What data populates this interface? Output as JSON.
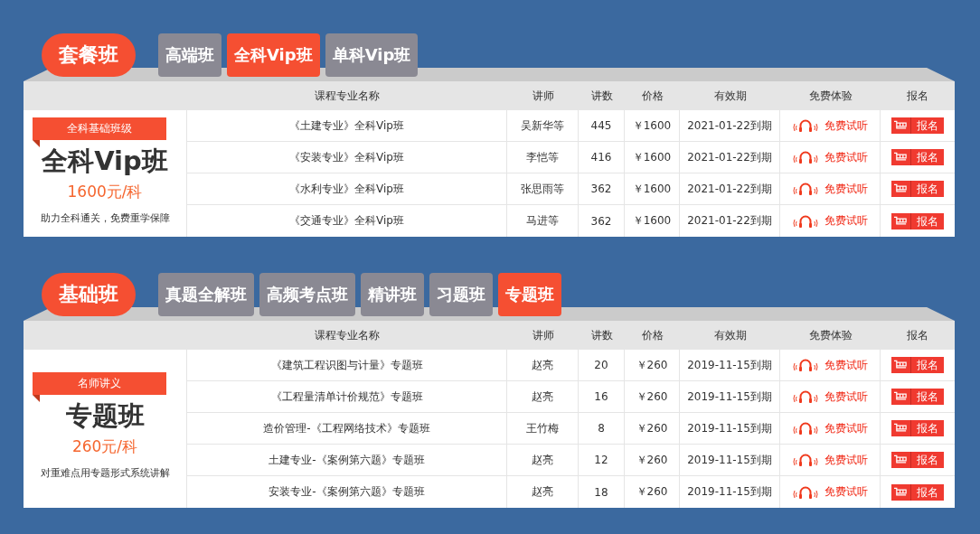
{
  "sections": [
    {
      "title": "套餐班",
      "tabs": [
        {
          "label": "高端班",
          "selected": false
        },
        {
          "label": "全科Vip班",
          "selected": true
        },
        {
          "label": "单科Vip班",
          "selected": false
        }
      ],
      "columns": [
        "课程专业名称",
        "讲师",
        "讲数",
        "价格",
        "有效期",
        "免费体验",
        "报名"
      ],
      "promo": {
        "tag": "全科基础班级",
        "title": "全科Vip班",
        "price": "1600元/科",
        "description": "助力全科通关，免费重学保障"
      },
      "rows": [
        {
          "name": "《土建专业》全科Vip班",
          "teacher": "吴新华等",
          "lessons": "445",
          "price": "￥1600",
          "expiry": "2021-01-22到期",
          "trial": "免费试听",
          "signup": "报名"
        },
        {
          "name": "《安装专业》全科Vip班",
          "teacher": "李恺等",
          "lessons": "416",
          "price": "￥1600",
          "expiry": "2021-01-22到期",
          "trial": "免费试听",
          "signup": "报名"
        },
        {
          "name": "《水利专业》全科Vip班",
          "teacher": "张思雨等",
          "lessons": "362",
          "price": "￥1600",
          "expiry": "2021-01-22到期",
          "trial": "免费试听",
          "signup": "报名"
        },
        {
          "name": "《交通专业》全科Vip班",
          "teacher": "马进等",
          "lessons": "362",
          "price": "￥1600",
          "expiry": "2021-01-22到期",
          "trial": "免费试听",
          "signup": "报名"
        }
      ]
    },
    {
      "title": "基础班",
      "tabs": [
        {
          "label": "真题全解班",
          "selected": false
        },
        {
          "label": "高频考点班",
          "selected": false
        },
        {
          "label": "精讲班",
          "selected": false
        },
        {
          "label": "习题班",
          "selected": false
        },
        {
          "label": "专题班",
          "selected": true
        }
      ],
      "columns": [
        "课程专业名称",
        "讲师",
        "讲数",
        "价格",
        "有效期",
        "免费体验",
        "报名"
      ],
      "promo": {
        "tag": "名师讲义",
        "title": "专题班",
        "price": "260元/科",
        "description": "对重难点用专题形式系统讲解"
      },
      "rows": [
        {
          "name": "《建筑工程识图与计量》专题班",
          "teacher": "赵亮",
          "lessons": "20",
          "price": "￥260",
          "expiry": "2019-11-15到期",
          "trial": "免费试听",
          "signup": "报名"
        },
        {
          "name": "《工程量清单计价规范》专题班",
          "teacher": "赵亮",
          "lessons": "16",
          "price": "￥260",
          "expiry": "2019-11-15到期",
          "trial": "免费试听",
          "signup": "报名"
        },
        {
          "name": "造价管理-《工程网络技术》专题班",
          "teacher": "王竹梅",
          "lessons": "8",
          "price": "￥260",
          "expiry": "2019-11-15到期",
          "trial": "免费试听",
          "signup": "报名"
        },
        {
          "name": "土建专业-《案例第六题》专题班",
          "teacher": "赵亮",
          "lessons": "12",
          "price": "￥260",
          "expiry": "2019-11-15到期",
          "trial": "免费试听",
          "signup": "报名"
        },
        {
          "name": "安装专业-《案例第六题》专题班",
          "teacher": "赵亮",
          "lessons": "18",
          "price": "￥260",
          "expiry": "2019-11-15到期",
          "trial": "免费试听",
          "signup": "报名"
        }
      ]
    }
  ]
}
